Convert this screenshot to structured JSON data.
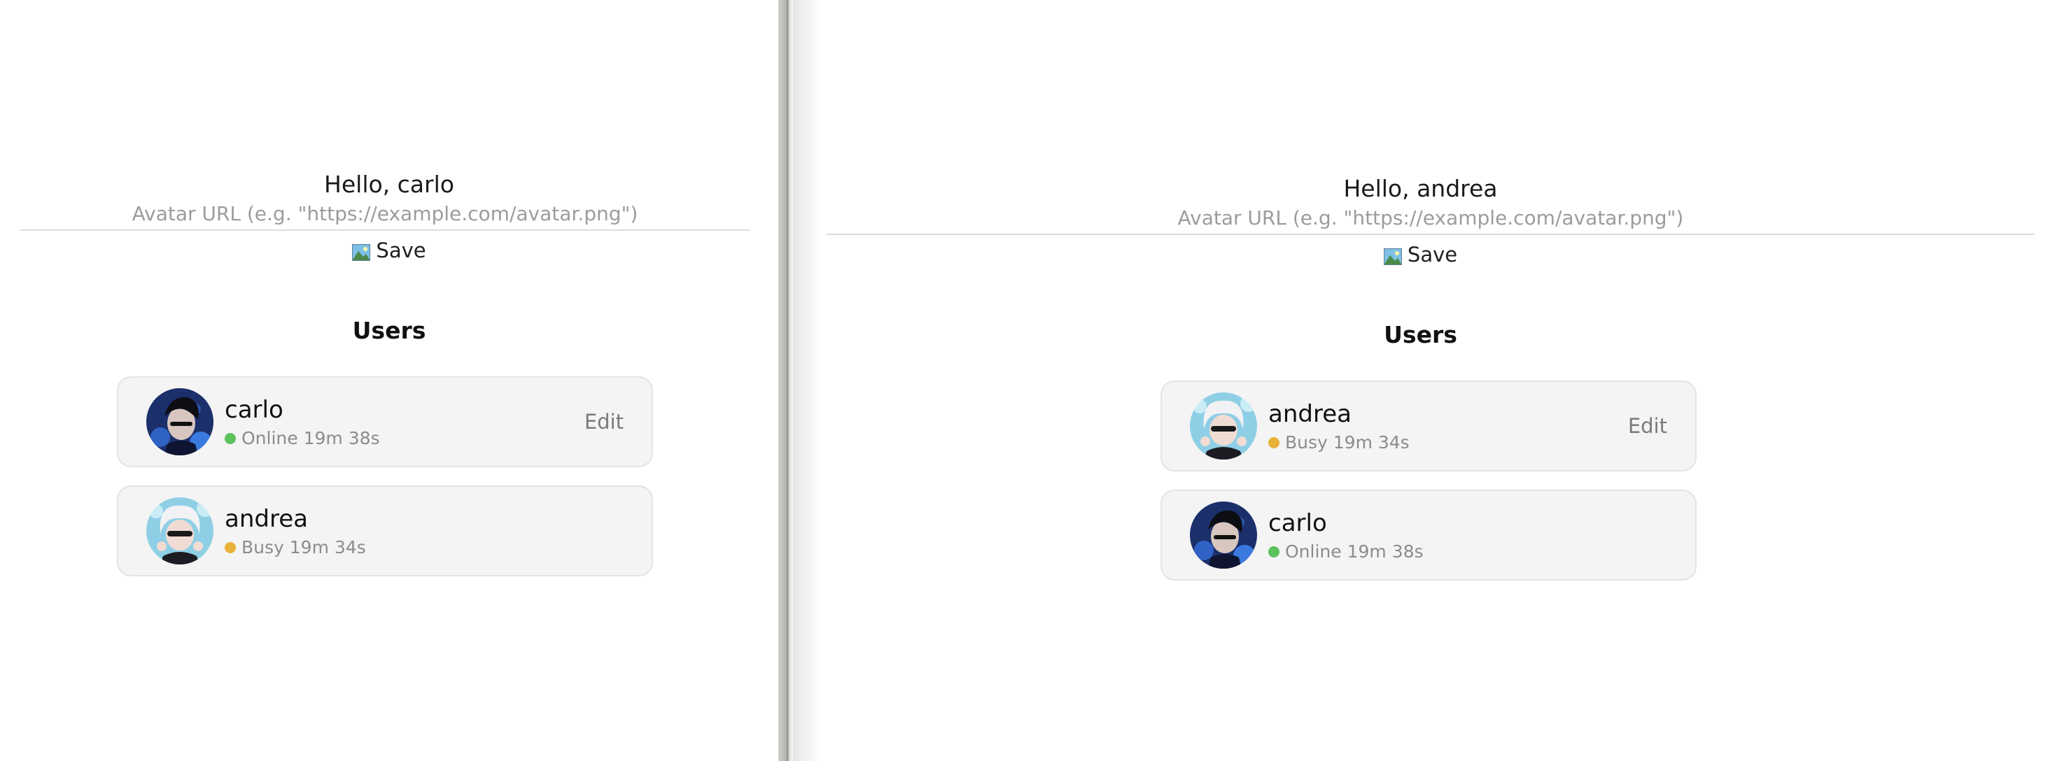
{
  "left_window": {
    "greeting": "Hello, carlo",
    "avatar_input": {
      "placeholder": "Avatar URL (e.g. \"https://example.com/avatar.png\")",
      "value": ""
    },
    "save_button": {
      "icon": "image-icon",
      "label": "Save"
    },
    "users_heading": "Users",
    "users": [
      {
        "name": "carlo",
        "status": "Online 19m 38s",
        "status_color": "#5cc25c",
        "avatar": "dark-haired-avatar",
        "action": "Edit"
      },
      {
        "name": "andrea",
        "status": "Busy 19m 34s",
        "status_color": "#e8b23a",
        "avatar": "white-haired-avatar"
      }
    ]
  },
  "right_window": {
    "greeting": "Hello, andrea",
    "avatar_input": {
      "placeholder": "Avatar URL (e.g. \"https://example.com/avatar.png\")",
      "value": ""
    },
    "save_button": {
      "icon": "image-icon",
      "label": "Save"
    },
    "users_heading": "Users",
    "users": [
      {
        "name": "andrea",
        "status": "Busy 19m 34s",
        "status_color": "#e8b23a",
        "avatar": "white-haired-avatar",
        "action": "Edit"
      },
      {
        "name": "carlo",
        "status": "Online 19m 38s",
        "status_color": "#5cc25c",
        "avatar": "dark-haired-avatar"
      }
    ]
  }
}
